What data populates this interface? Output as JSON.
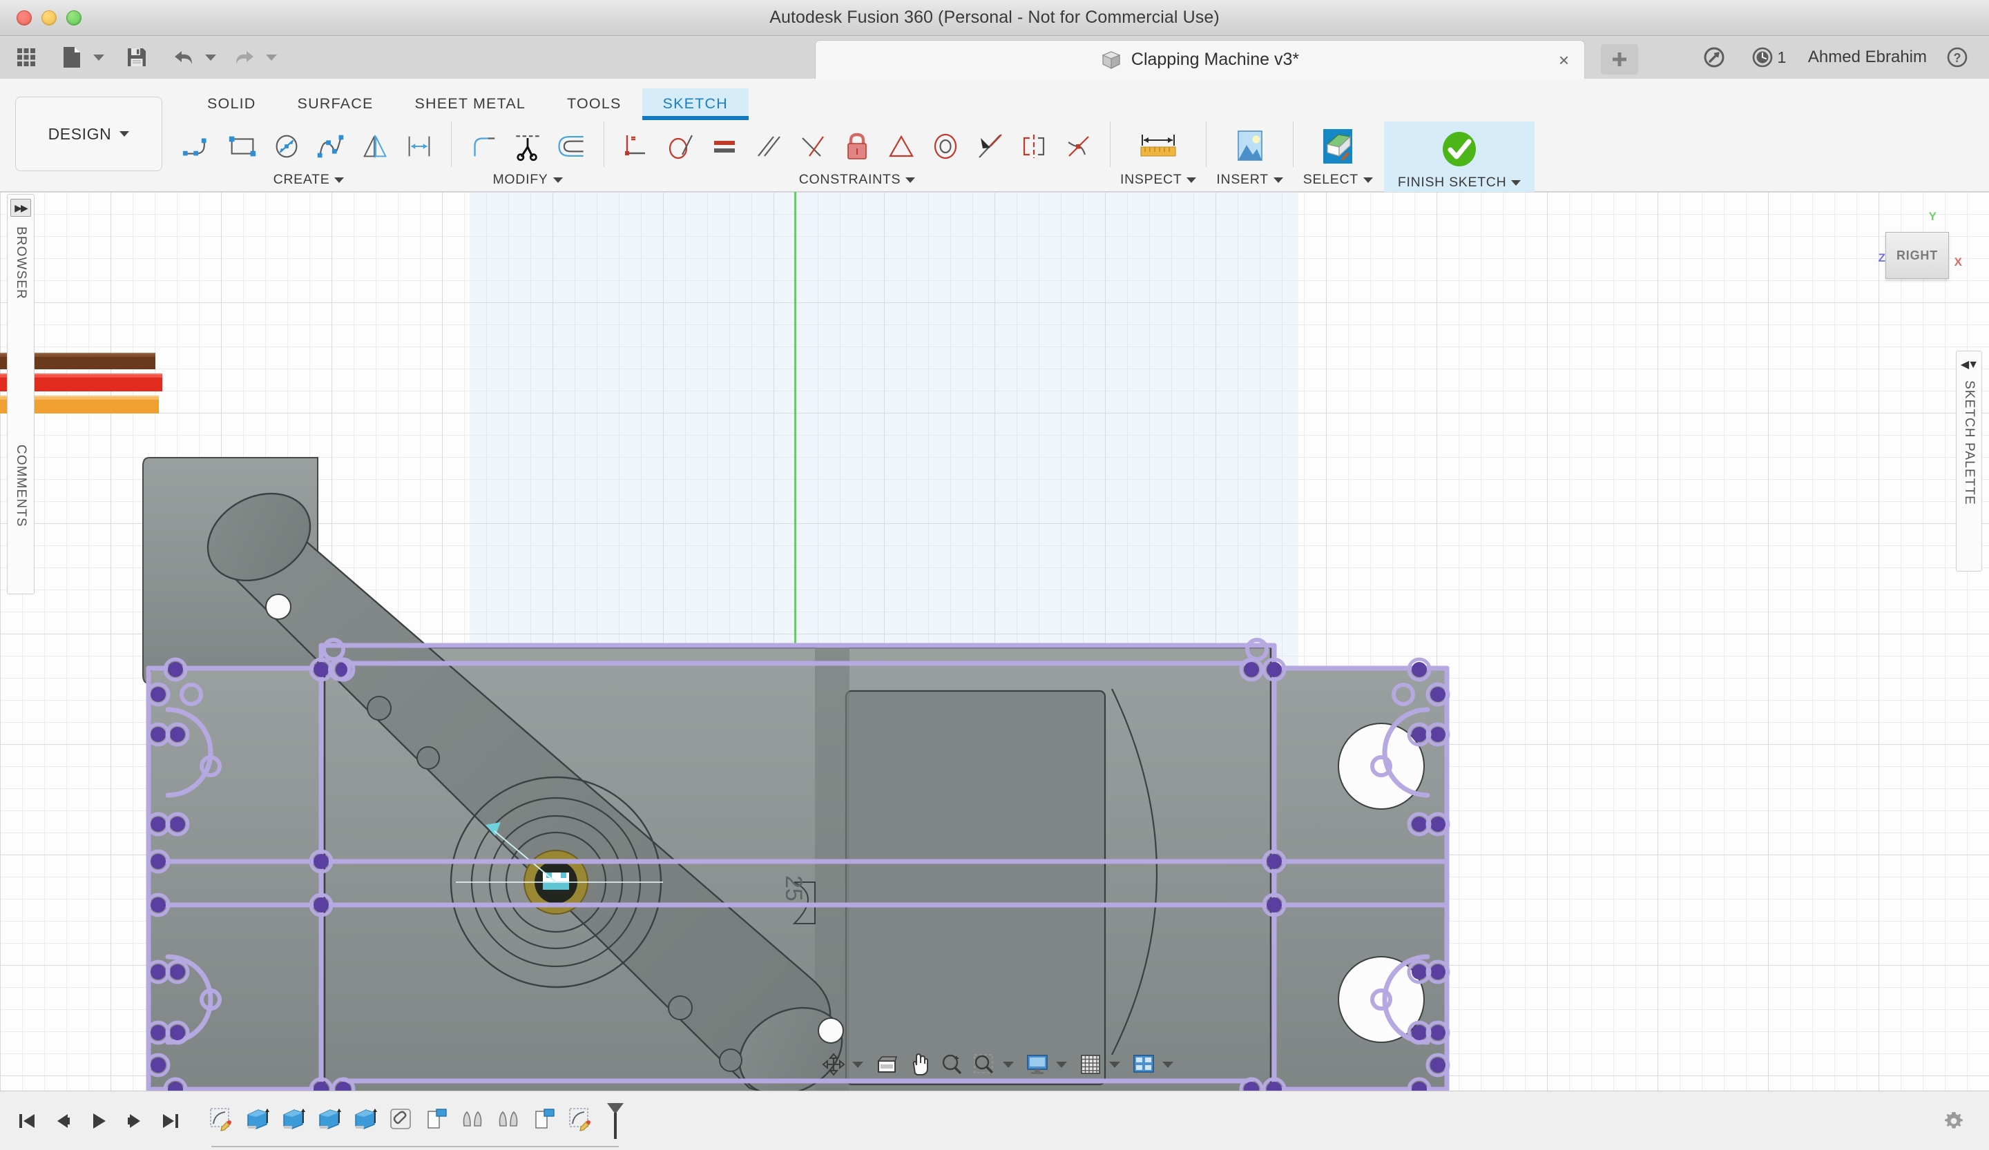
{
  "window": {
    "title": "Autodesk Fusion 360 (Personal - Not for Commercial Use)",
    "traffic_lights": [
      "close",
      "minimize",
      "maximize"
    ]
  },
  "appbar": {
    "apps_grid_label": "apps-grid",
    "new_label": "new-file",
    "save_label": "save",
    "undo_label": "undo",
    "redo_label": "redo",
    "document_tab": {
      "name": "Clapping Machine v3*",
      "close_label": "×"
    },
    "new_tab_label": "+",
    "sync_label": "sync",
    "notifications_count": "1",
    "user_name": "Ahmed Ebrahim",
    "help_label": "?"
  },
  "ribbon": {
    "workspace": "DESIGN",
    "workspace_caret": "▼",
    "tabs": [
      {
        "label": "SOLID",
        "active": false
      },
      {
        "label": "SURFACE",
        "active": false
      },
      {
        "label": "SHEET METAL",
        "active": false
      },
      {
        "label": "TOOLS",
        "active": false
      },
      {
        "label": "SKETCH",
        "active": true
      }
    ],
    "groups": [
      {
        "label": "CREATE",
        "caret": "▼",
        "tools": [
          "line-icon",
          "rectangle-icon",
          "circle-icon",
          "spline-icon",
          "mirror-icon",
          "rectangular-pattern-icon"
        ]
      },
      {
        "label": "MODIFY",
        "caret": "▼",
        "tools": [
          "fillet-icon",
          "trim-icon",
          "offset-icon"
        ]
      },
      {
        "label": "CONSTRAINTS",
        "caret": "▼",
        "tools": [
          "coincident-icon",
          "perpendicular-icon",
          "tangent-icon",
          "equal-icon",
          "parallel-icon",
          "midpoint-icon",
          "fix-lock-icon",
          "collinear-icon",
          "concentric-icon",
          "horizontal-vertical-icon",
          "symmetry-icon",
          "curvature-icon"
        ]
      },
      {
        "label": "INSPECT",
        "caret": "▼",
        "tools": [
          "measure-icon"
        ]
      },
      {
        "label": "INSERT",
        "caret": "▼",
        "tools": [
          "insert-image-icon"
        ]
      },
      {
        "label": "SELECT",
        "caret": "▼",
        "tools": [
          "select-filter-icon"
        ]
      },
      {
        "label": "FINISH SKETCH",
        "caret": "▼",
        "tools": [
          "finish-sketch-check-icon"
        ],
        "highlighted": true
      }
    ]
  },
  "panels": {
    "browser": {
      "label": "BROWSER",
      "expand_glyph": "▶▶",
      "collapsed": true
    },
    "comments": {
      "label": "COMMENTS",
      "collapsed": true
    },
    "sketch_palette": {
      "label": "SKETCH PALETTE",
      "collapse_glyph": "◀▼",
      "collapsed": true
    }
  },
  "viewcube": {
    "face": "RIGHT",
    "axes": {
      "y": "Y",
      "z": "Z",
      "x": "X"
    },
    "colors": {
      "y": "#6ece6e",
      "z": "#7272e6",
      "x": "#e06666"
    }
  },
  "canvas": {
    "model_label": "25",
    "sketch_line_color": "#b6a8e0",
    "sketch_point_color": "#5b3fa0",
    "body_color": "#8a9190",
    "axis_color": "#5cd45c",
    "wires": [
      {
        "name": "brown-wire",
        "color": "#6b3a1c"
      },
      {
        "name": "red-wire",
        "color": "#e02b1e"
      },
      {
        "name": "orange-wire",
        "color": "#f0a030"
      }
    ]
  },
  "navbar": {
    "tools": [
      {
        "name": "orbit-icon",
        "caret": true
      },
      {
        "name": "look-at-icon",
        "caret": false
      },
      {
        "name": "pan-icon",
        "caret": false
      },
      {
        "name": "zoom-icon",
        "caret": false
      },
      {
        "name": "zoom-window-icon",
        "caret": true
      },
      {
        "name": "display-settings-icon",
        "caret": true
      },
      {
        "name": "grid-snaps-icon",
        "caret": true
      },
      {
        "name": "viewports-icon",
        "caret": true
      }
    ]
  },
  "timeline": {
    "controls": [
      {
        "name": "go-to-beginning-button",
        "glyph": "⏮"
      },
      {
        "name": "step-back-button",
        "glyph": "◀"
      },
      {
        "name": "play-button",
        "glyph": "▶"
      },
      {
        "name": "step-forward-button",
        "glyph": "▶"
      },
      {
        "name": "go-to-end-button",
        "glyph": "⏭"
      }
    ],
    "features": [
      {
        "name": "timeline-sketch-1",
        "type": "sketch"
      },
      {
        "name": "timeline-extrude-1",
        "type": "extrude"
      },
      {
        "name": "timeline-extrude-2",
        "type": "extrude"
      },
      {
        "name": "timeline-extrude-3",
        "type": "extrude"
      },
      {
        "name": "timeline-extrude-4",
        "type": "extrude"
      },
      {
        "name": "timeline-joint-1",
        "type": "joint"
      },
      {
        "name": "timeline-plane-1",
        "type": "offset-plane"
      },
      {
        "name": "timeline-mirror-1",
        "type": "mirror"
      },
      {
        "name": "timeline-mirror-2",
        "type": "mirror"
      },
      {
        "name": "timeline-plane-2",
        "type": "offset-plane"
      },
      {
        "name": "timeline-sketch-2",
        "type": "sketch"
      }
    ],
    "settings_label": "timeline-settings"
  }
}
